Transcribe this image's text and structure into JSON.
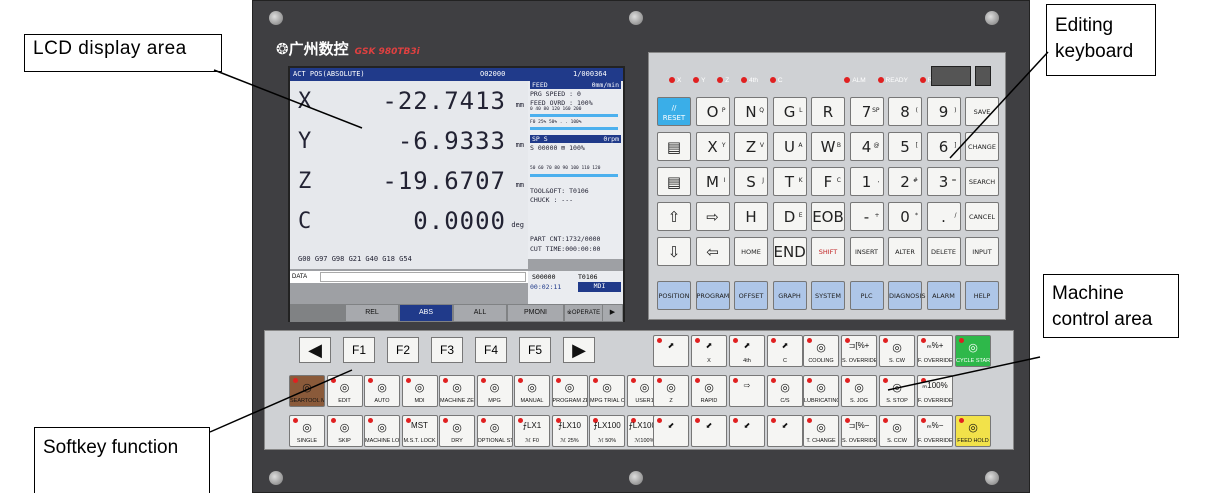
{
  "logo": {
    "text": "❂广州数控",
    "model": "GSK 980TB3i"
  },
  "lcd": {
    "header": {
      "mode": "ACT POS(ABSOLUTE)",
      "prog": "O02000",
      "line": "1/000364"
    },
    "axes": [
      {
        "axis": "X",
        "value": "-22.7413",
        "unit": "mm"
      },
      {
        "axis": "Y",
        "value": "-6.9333",
        "unit": "mm"
      },
      {
        "axis": "Z",
        "value": "-19.6707",
        "unit": "mm"
      },
      {
        "axis": "C",
        "value": "0.0000",
        "unit": "deg"
      }
    ],
    "feed": {
      "title": "FEED",
      "unit": "0mm/min",
      "prg_speed": "PRG SPEED :    0",
      "ovrd": "FEED OVRD :  100%",
      "scale1": "0  40  80  120  160  200",
      "scale2": "F0   25%  50%  .  .  100%"
    },
    "spindle": {
      "title": "SP   S",
      "unit": "0rpm",
      "s_line": "S 00000    ⊞ 100%",
      "scale": "50 60 70 80 90 100 110 120"
    },
    "tool": {
      "toolsoft": "TOOL&OFT:   T0106",
      "chuck": "CHUCK  :   ---"
    },
    "gcodes": "G00  G97  G98  G21  G40  G18  G54",
    "part_cnt": "PART CNT:1732/0000",
    "cut_time": "CUT TIME:000:00:00",
    "status_s": "S00000",
    "status_t": "T0106",
    "clock": "00:02:11",
    "mode": "MDI",
    "data_label": "DATA",
    "softkeys": [
      "REL",
      "ABS",
      "ALL",
      "PMONI",
      "※OPERATE",
      "▶"
    ]
  },
  "leds": [
    "X",
    "Y",
    "Z",
    "4th",
    "C",
    "ALM",
    "READY",
    "RUN"
  ],
  "keyboard": {
    "row1": [
      "//\nRESET",
      "O",
      "N",
      "G",
      "R",
      "7",
      "8",
      "9",
      "SAVE"
    ],
    "row1sub": [
      "",
      "P",
      "Q",
      "L",
      "",
      "SP",
      "(",
      ")",
      ""
    ],
    "row2": [
      "▤",
      "X",
      "Z",
      "U",
      "W",
      "4",
      "5",
      "6",
      "CHANGE"
    ],
    "row2sub": [
      "",
      "Y",
      "V",
      "A",
      "B",
      "@",
      "[",
      "]",
      ""
    ],
    "row3": [
      "▤",
      "M",
      "S",
      "T",
      "F",
      "1",
      "2",
      "3",
      "SEARCH"
    ],
    "row3sub": [
      "",
      "I",
      "J",
      "K",
      "C",
      ",",
      "#",
      "=",
      ""
    ],
    "row4": [
      "⇧",
      "⇨",
      "H",
      "D",
      "EOB",
      "-",
      "0",
      ".",
      "CANCEL"
    ],
    "row4sub": [
      "",
      "",
      "",
      "E",
      "",
      "+",
      "*",
      "/",
      ""
    ],
    "row5": [
      "⇩",
      "⇦",
      "HOME",
      "END",
      "SHIFT",
      "INSERT",
      "ALTER",
      "DELETE",
      "INPUT"
    ],
    "row6": [
      "POSITION",
      "PROGRAM",
      "OFFSET",
      "GRAPH",
      "SYSTEM",
      "PLC",
      "DIAGNOSIS",
      "ALARM",
      "HELP"
    ]
  },
  "fkeys": [
    "◀",
    "F1",
    "F2",
    "F3",
    "F4",
    "F5",
    "▶"
  ],
  "mrow1": [
    "SEARTOOL MAGAZ",
    "EDIT",
    "AUTO",
    "MDI",
    "MACHINE ZERO",
    "MPG",
    "MANUAL",
    "PROGRAM ZERO",
    "MPG TRIAL CUT",
    "USER1"
  ],
  "mrow2": [
    "SINGLE",
    "SKIP",
    "MACHINE LOCK",
    "M.S.T. LOCK",
    "DRY",
    "OPTIONAL STOP",
    "ℳ F0",
    "ℳ 25%",
    "ℳ 50%",
    "ℳ100%"
  ],
  "mrow2top": [
    "",
    "",
    "",
    "MST",
    "",
    "",
    "⨍LX1",
    "⨍LX10",
    "⨍LX100",
    "⨍LX1000"
  ],
  "jog": {
    "r1": [
      "",
      "X",
      "4th",
      "C"
    ],
    "r2": [
      "Z",
      "RAPID",
      "",
      "C/S"
    ],
    "r3": [
      "",
      "",
      "",
      ""
    ]
  },
  "jog_axes": [
    "Y",
    "X",
    "4th",
    "C",
    "Z"
  ],
  "spindle_keys": {
    "r1": [
      "COOLING",
      "S. OVERRIDE",
      "S. CW",
      "F. OVERRIDE",
      "CYCLE START"
    ],
    "r2": [
      "LUBRICATING",
      "S. JOG",
      "S. STOP",
      "F. OVERRIDE"
    ],
    "r3": [
      "T. CHANGE",
      "S. OVERRIDE",
      "S. CCW",
      "F. OVERRIDE",
      "FEED HOLD"
    ],
    "r1top": [
      "",
      "⊐[%+",
      "",
      "ₘ%+",
      ""
    ],
    "r2top": [
      "",
      "",
      "",
      "ₘ100%"
    ],
    "r3top": [
      "",
      "⊐[%−",
      "",
      "ₘ%−",
      ""
    ]
  },
  "callouts": {
    "lcd": "LCD         display area",
    "keyboard": "Editing keyboard",
    "machine": "Machine control area",
    "softkey": "Softkey function"
  }
}
